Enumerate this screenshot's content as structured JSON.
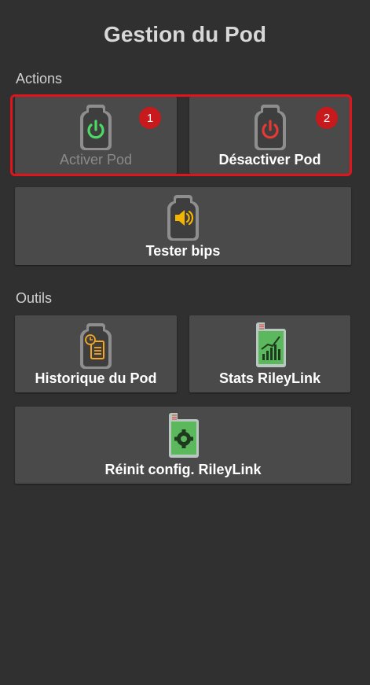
{
  "header": {
    "title": "Gestion du Pod"
  },
  "sections": {
    "actions": "Actions",
    "tools": "Outils"
  },
  "actions": {
    "activate": {
      "label": "Activer Pod",
      "badge": "1",
      "icon": "pod-power-green-icon",
      "color": "#4cd964"
    },
    "deactivate": {
      "label": "Désactiver Pod",
      "badge": "2",
      "icon": "pod-power-red-icon",
      "color": "#e53935"
    },
    "test_beeps": {
      "label": "Tester bips",
      "icon": "pod-speaker-icon",
      "color": "#f5b400"
    }
  },
  "tools": {
    "pod_history": {
      "label": "Historique du Pod",
      "icon": "pod-history-icon",
      "color": "#f5a623"
    },
    "rileylink_stats": {
      "label": "Stats RileyLink",
      "icon": "rileylink-stats-icon",
      "color": "#5cb85c"
    },
    "rileylink_reset": {
      "label": "Réinit config. RileyLink",
      "icon": "rileylink-config-icon",
      "color": "#5cb85c"
    }
  },
  "colors": {
    "background": "#303030",
    "button": "#4a4a4a",
    "highlight": "#e0141a"
  }
}
